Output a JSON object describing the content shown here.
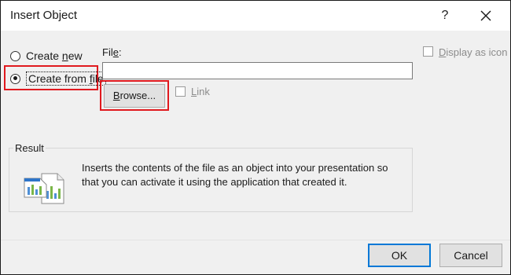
{
  "dialog": {
    "title": "Insert Object",
    "help_label": "?"
  },
  "options": {
    "create_new_label_pre": "Create ",
    "create_new_label_key": "n",
    "create_new_label_post": "ew",
    "create_new_selected": false,
    "create_from_file_label_pre": "Create from ",
    "create_from_file_label_key": "f",
    "create_from_file_label_post": "ile",
    "create_from_file_selected": true
  },
  "file": {
    "label_pre": "Fil",
    "label_key": "e",
    "label_post": ":",
    "value": "",
    "browse_label_pre": "",
    "browse_label_key": "B",
    "browse_label_post": "rowse...",
    "link_label_key": "L",
    "link_label_post": "ink",
    "link_checked": false
  },
  "display_as_icon": {
    "label_pre": "",
    "label_key": "D",
    "label_post": "isplay as icon",
    "checked": false
  },
  "result": {
    "legend": "Result",
    "description": "Inserts the contents of the file as an object into your presentation so that you can activate it using the application that created it.",
    "icon": "chart-document-icon"
  },
  "footer": {
    "ok_label": "OK",
    "cancel_label": "Cancel"
  },
  "colors": {
    "highlight": "#e0191e",
    "focus_border": "#0078d7"
  }
}
